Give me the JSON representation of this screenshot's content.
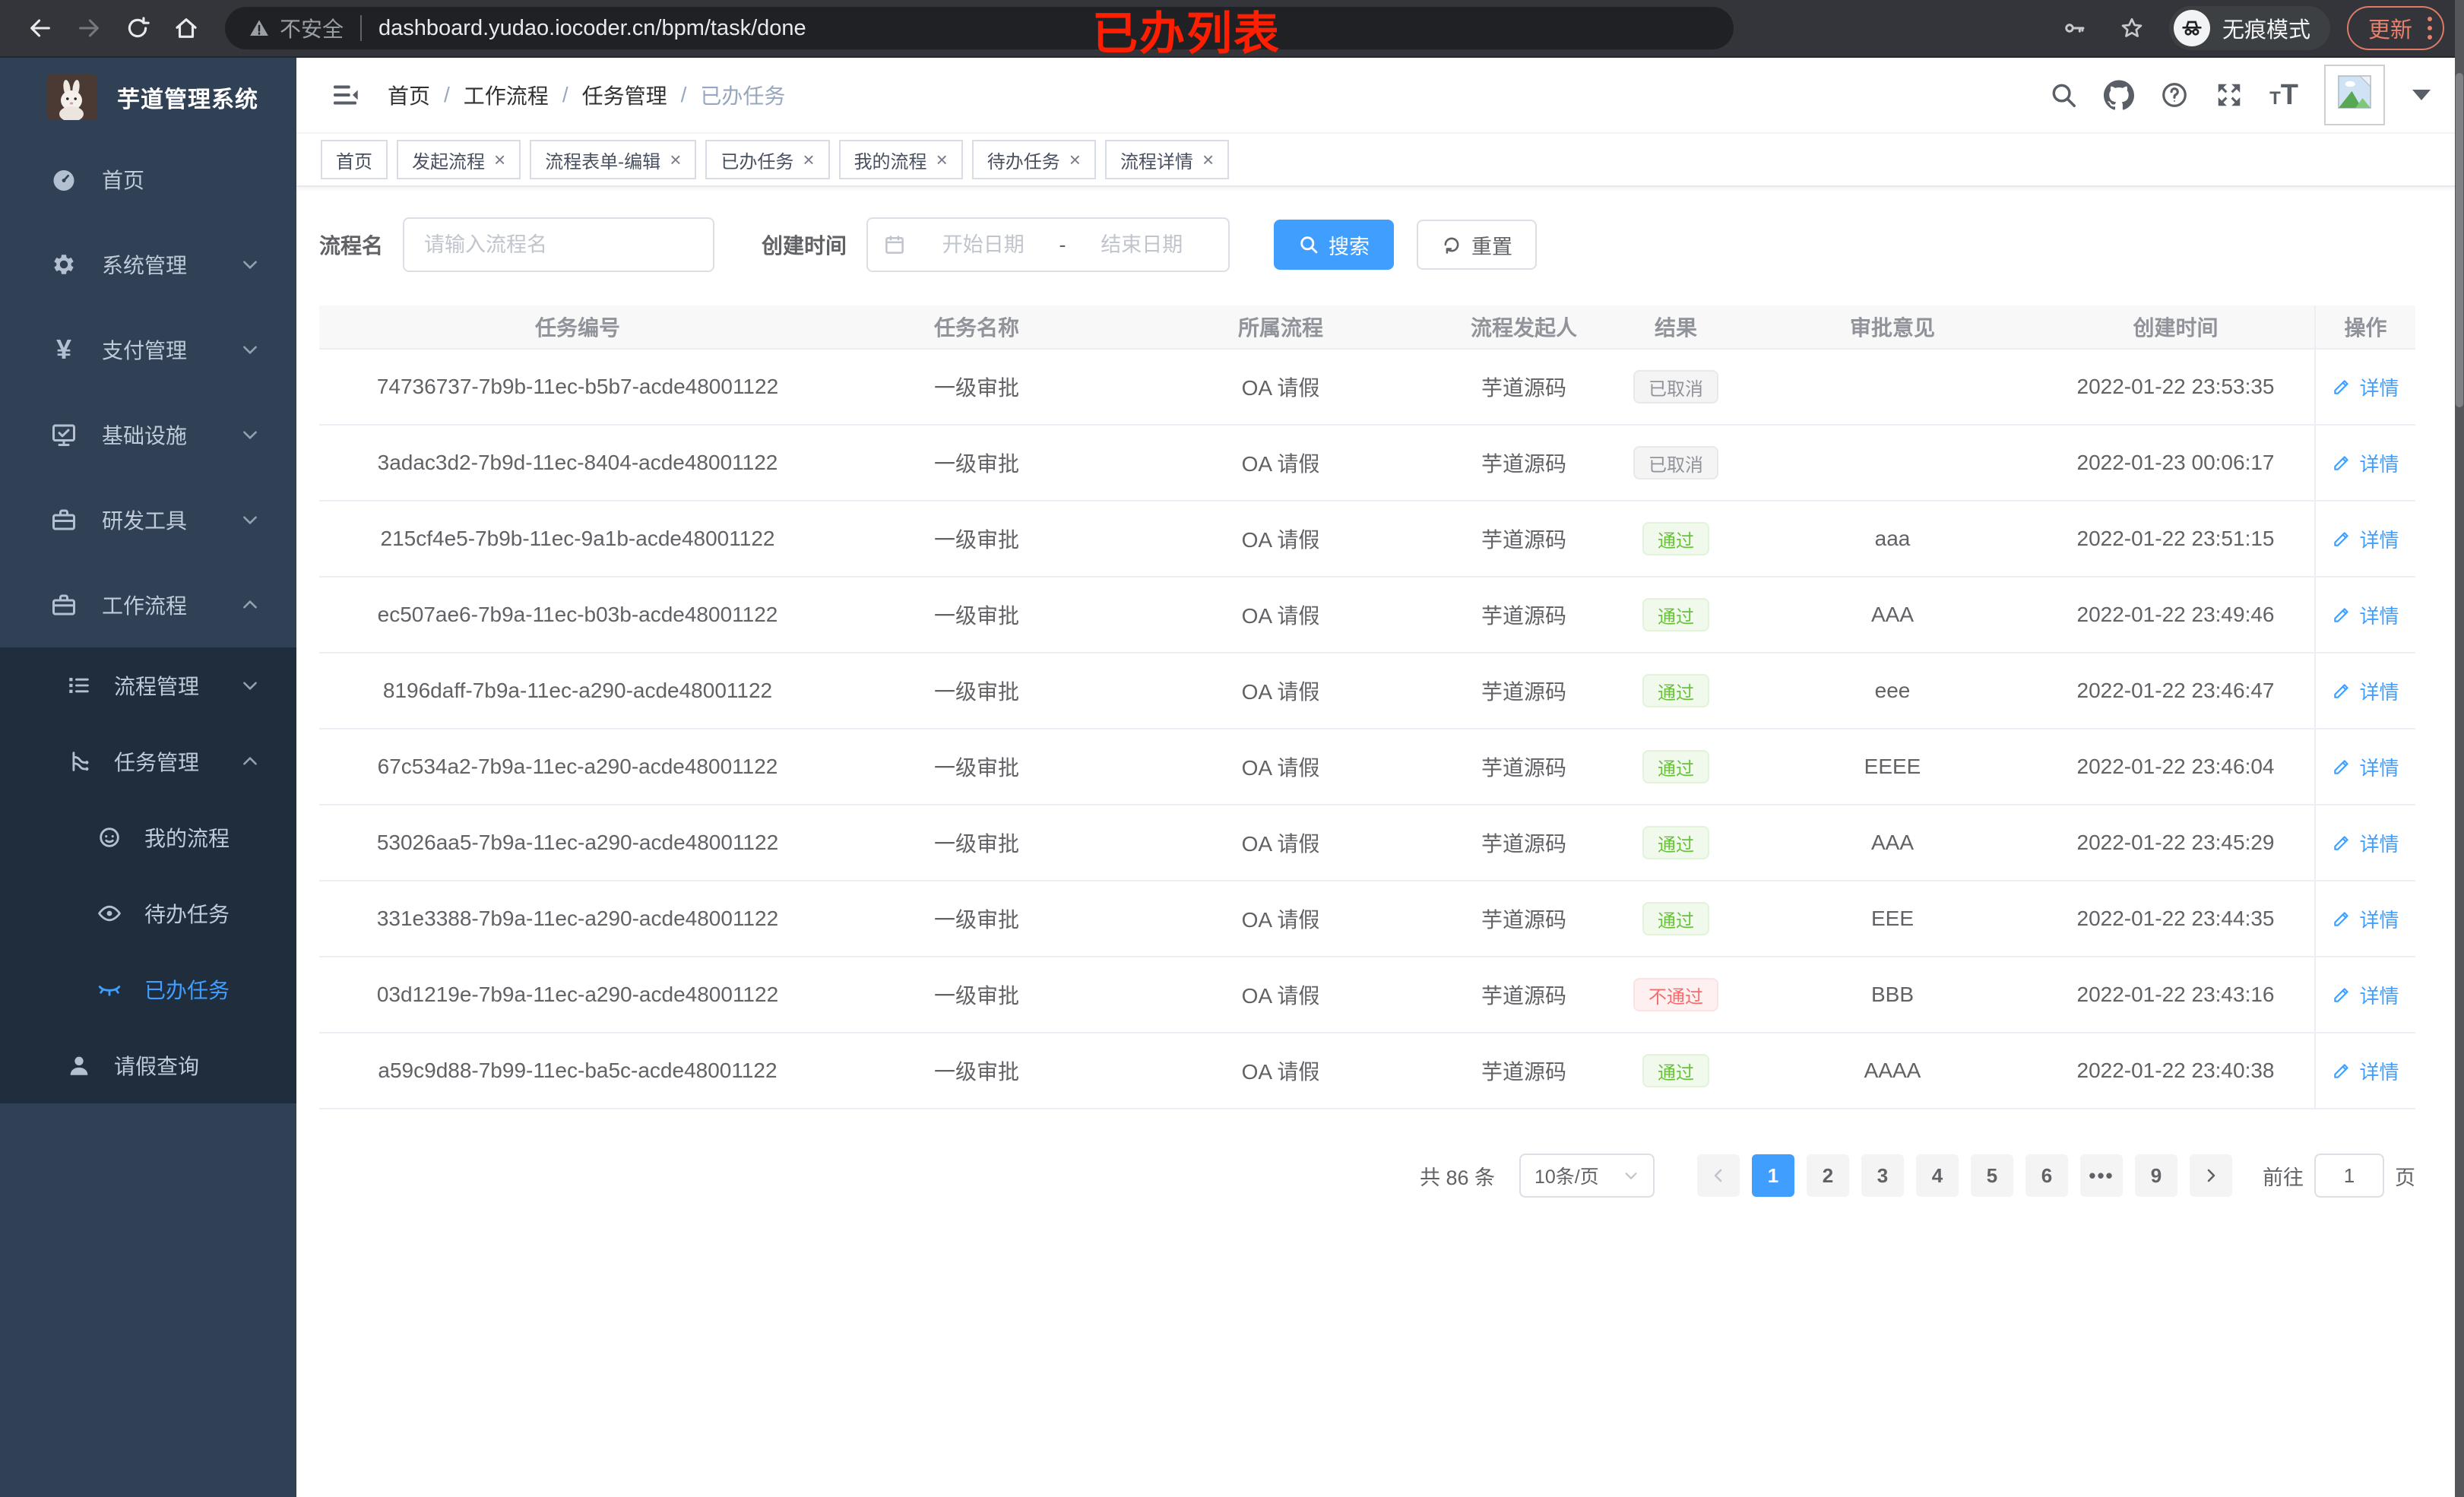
{
  "browser": {
    "security_label": "不安全",
    "url": "dashboard.yudao.iocoder.cn/bpm/task/done",
    "incognito_label": "无痕模式",
    "update_label": "更新",
    "annotation": "已办列表"
  },
  "sidebar": {
    "app_title": "芋道管理系统",
    "menu": [
      {
        "label": "首页"
      },
      {
        "label": "系统管理"
      },
      {
        "label": "支付管理"
      },
      {
        "label": "基础设施"
      },
      {
        "label": "研发工具"
      },
      {
        "label": "工作流程"
      }
    ],
    "submenu": [
      {
        "label": "流程管理"
      },
      {
        "label": "任务管理"
      }
    ],
    "task_children": [
      {
        "label": "我的流程"
      },
      {
        "label": "待办任务"
      },
      {
        "label": "已办任务",
        "active": true
      }
    ],
    "leave_query": {
      "label": "请假查询"
    }
  },
  "navbar": {
    "separator": "/",
    "breadcrumb": [
      "首页",
      "工作流程",
      "任务管理",
      "已办任务"
    ]
  },
  "tags": {
    "items": [
      {
        "label": "首页"
      },
      {
        "label": "发起流程",
        "closable": true
      },
      {
        "label": "流程表单-编辑",
        "closable": true
      },
      {
        "label": "已办任务",
        "closable": true,
        "active": true
      },
      {
        "label": "我的流程",
        "closable": true
      },
      {
        "label": "待办任务",
        "closable": true
      },
      {
        "label": "流程详情",
        "closable": true
      }
    ],
    "close_glyph": "×"
  },
  "filters": {
    "name_label": "流程名",
    "name_placeholder": "请输入流程名",
    "time_label": "创建时间",
    "start_placeholder": "开始日期",
    "range_separator": "-",
    "end_placeholder": "结束日期",
    "search_label": "搜索",
    "reset_label": "重置"
  },
  "table": {
    "columns": [
      "任务编号",
      "任务名称",
      "所属流程",
      "流程发起人",
      "结果",
      "审批意见",
      "创建时间",
      "操作"
    ],
    "detail_label": "详情",
    "rows": [
      {
        "id": "74736737-7b9b-11ec-b5b7-acde48001122",
        "name": "一级审批",
        "process": "OA 请假",
        "starter": "芋道源码",
        "result": "已取消",
        "result_type": "info",
        "comment": "",
        "created": "2022-01-22 23:53:35"
      },
      {
        "id": "3adac3d2-7b9d-11ec-8404-acde48001122",
        "name": "一级审批",
        "process": "OA 请假",
        "starter": "芋道源码",
        "result": "已取消",
        "result_type": "info",
        "comment": "",
        "created": "2022-01-23 00:06:17"
      },
      {
        "id": "215cf4e5-7b9b-11ec-9a1b-acde48001122",
        "name": "一级审批",
        "process": "OA 请假",
        "starter": "芋道源码",
        "result": "通过",
        "result_type": "success",
        "comment": "aaa",
        "created": "2022-01-22 23:51:15"
      },
      {
        "id": "ec507ae6-7b9a-11ec-b03b-acde48001122",
        "name": "一级审批",
        "process": "OA 请假",
        "starter": "芋道源码",
        "result": "通过",
        "result_type": "success",
        "comment": "AAA",
        "created": "2022-01-22 23:49:46"
      },
      {
        "id": "8196daff-7b9a-11ec-a290-acde48001122",
        "name": "一级审批",
        "process": "OA 请假",
        "starter": "芋道源码",
        "result": "通过",
        "result_type": "success",
        "comment": "eee",
        "created": "2022-01-22 23:46:47"
      },
      {
        "id": "67c534a2-7b9a-11ec-a290-acde48001122",
        "name": "一级审批",
        "process": "OA 请假",
        "starter": "芋道源码",
        "result": "通过",
        "result_type": "success",
        "comment": "EEEE",
        "created": "2022-01-22 23:46:04"
      },
      {
        "id": "53026aa5-7b9a-11ec-a290-acde48001122",
        "name": "一级审批",
        "process": "OA 请假",
        "starter": "芋道源码",
        "result": "通过",
        "result_type": "success",
        "comment": "AAA",
        "created": "2022-01-22 23:45:29"
      },
      {
        "id": "331e3388-7b9a-11ec-a290-acde48001122",
        "name": "一级审批",
        "process": "OA 请假",
        "starter": "芋道源码",
        "result": "通过",
        "result_type": "success",
        "comment": "EEE",
        "created": "2022-01-22 23:44:35"
      },
      {
        "id": "03d1219e-7b9a-11ec-a290-acde48001122",
        "name": "一级审批",
        "process": "OA 请假",
        "starter": "芋道源码",
        "result": "不通过",
        "result_type": "danger",
        "comment": "BBB",
        "created": "2022-01-22 23:43:16"
      },
      {
        "id": "a59c9d88-7b99-11ec-ba5c-acde48001122",
        "name": "一级审批",
        "process": "OA 请假",
        "starter": "芋道源码",
        "result": "通过",
        "result_type": "success",
        "comment": "AAAA",
        "created": "2022-01-22 23:40:38"
      }
    ]
  },
  "pagination": {
    "total_label": "共 86 条",
    "page_size": "10条/页",
    "pages": [
      {
        "label": "1",
        "type": "active"
      },
      {
        "label": "2"
      },
      {
        "label": "3"
      },
      {
        "label": "4"
      },
      {
        "label": "5"
      },
      {
        "label": "6"
      },
      {
        "label": "•••",
        "type": "ellipsis"
      },
      {
        "label": "9"
      }
    ],
    "goto_label": "前往",
    "goto_value": "1",
    "page_unit": "页"
  },
  "colors": {
    "accent": "#409eff",
    "sidebar_bg": "#304156",
    "submenu_bg": "#1f2d3d",
    "success_text": "#67c23a",
    "danger_text": "#f56c6c",
    "info_text": "#909399",
    "annotation_red": "#ff1f00",
    "update_orange": "#e8806b"
  }
}
